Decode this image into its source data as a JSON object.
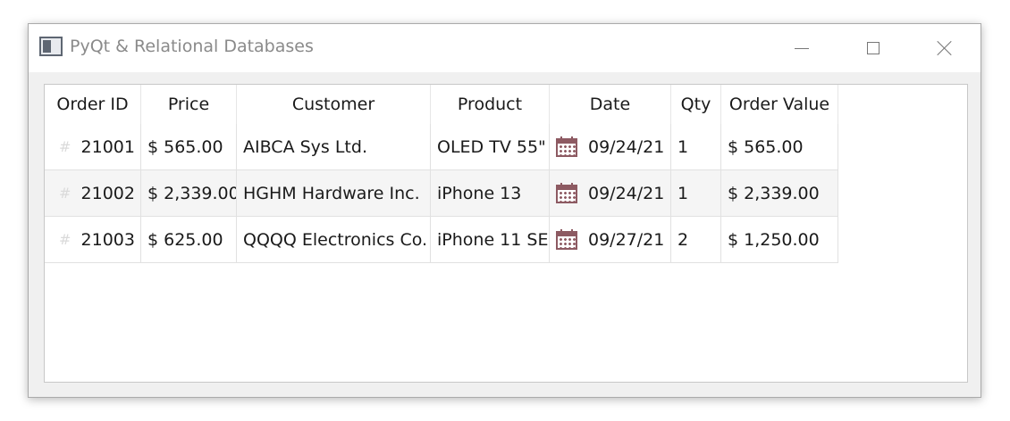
{
  "window": {
    "title": "PyQt & Relational Databases"
  },
  "table": {
    "headers": [
      "Order ID",
      "Price",
      "Customer",
      "Product",
      "Date",
      "Qty",
      "Order Value"
    ],
    "rows": [
      {
        "id_icon": "#",
        "order_id": "21001",
        "price": "$ 565.00",
        "customer": "AIBCA Sys Ltd.",
        "product": "OLED TV 55\"",
        "date": "09/24/21",
        "qty": "1",
        "order_value": "$ 565.00"
      },
      {
        "id_icon": "#",
        "order_id": "21002",
        "price": "$ 2,339.00",
        "customer": "HGHM Hardware Inc.",
        "product": "iPhone 13",
        "date": "09/24/21",
        "qty": "1",
        "order_value": "$ 2,339.00"
      },
      {
        "id_icon": "#",
        "order_id": "21003",
        "price": "$ 625.00",
        "customer": "QQQQ Electronics Co.",
        "product": "iPhone 11 SE",
        "date": "09/27/21",
        "qty": "2",
        "order_value": "$ 1,250.00"
      }
    ]
  },
  "icons": {
    "app": "app-window-icon",
    "row_id": "hash-icon",
    "date": "calendar-icon"
  },
  "colors": {
    "calendar_icon": "#8d5a62",
    "alt_row": "#f5f5f5",
    "title_text": "#8a8a8a"
  }
}
